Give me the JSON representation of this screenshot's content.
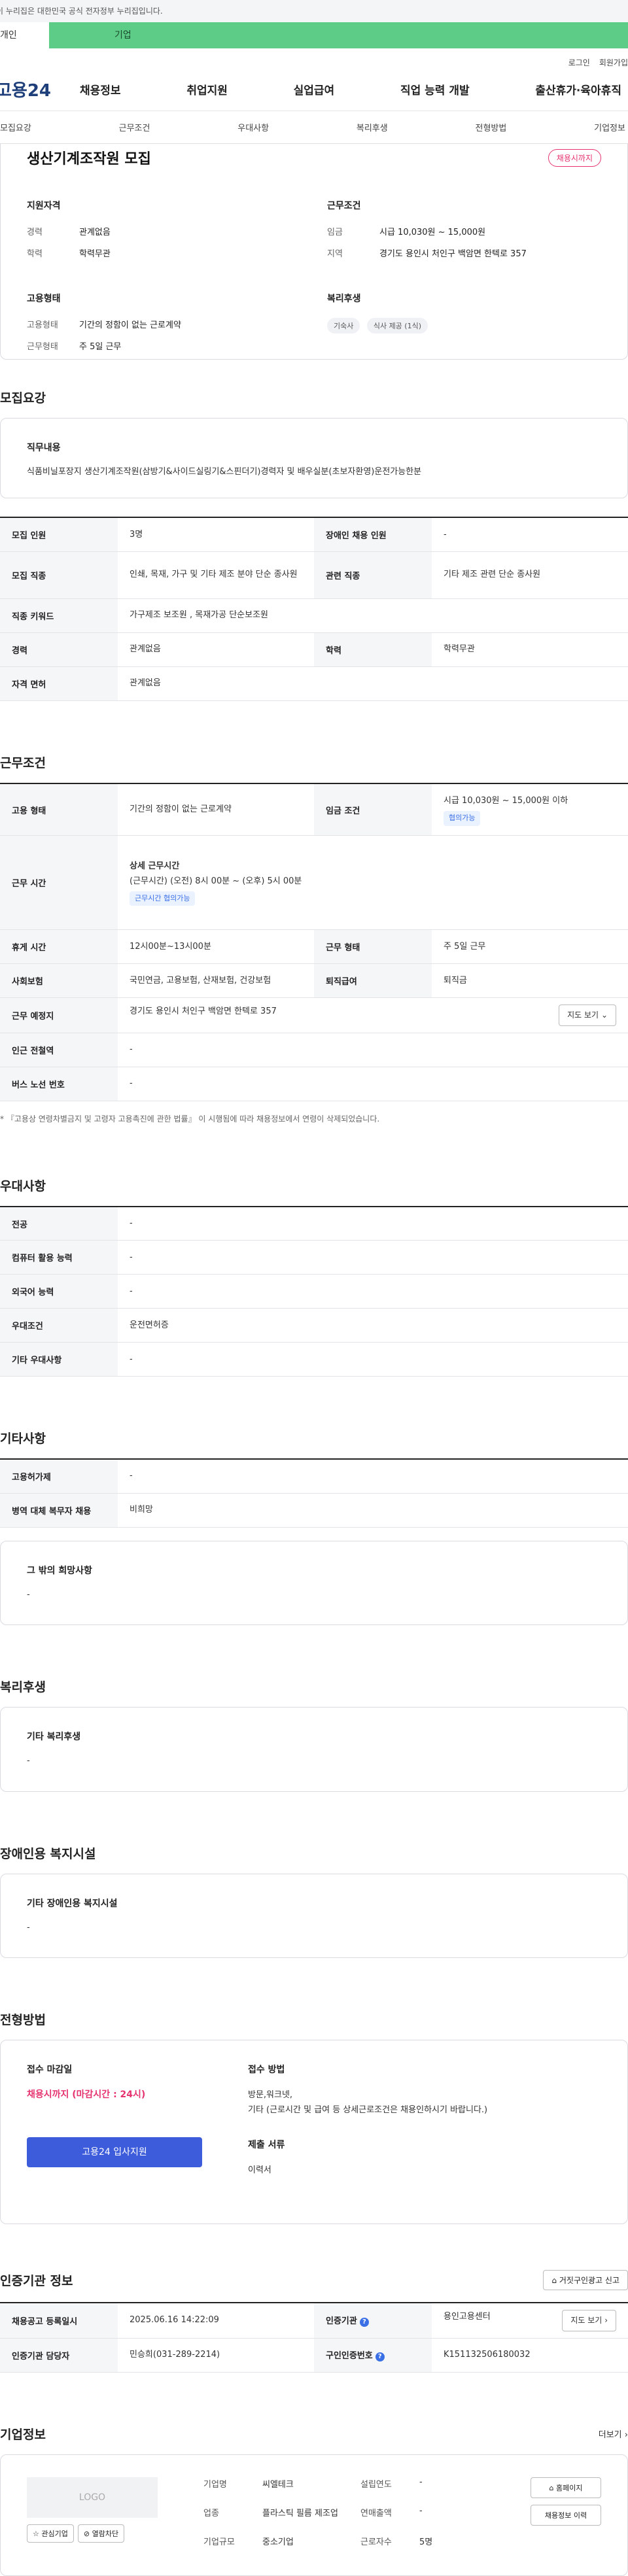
{
  "banner": {
    "text": "이 누리집은 대한민국 공식 전자정부 누리집입니다."
  },
  "audience": {
    "tabs": [
      "개인",
      "기업"
    ]
  },
  "util": {
    "login": "로그인",
    "signup": "회원가입"
  },
  "gnb": {
    "logo": "고용24",
    "items": [
      "채용정보",
      "취업지원",
      "실업급여",
      "직업 능력 개발",
      "출산휴가·육아휴직"
    ]
  },
  "anchors": [
    "모집요강",
    "근무조건",
    "우대사항",
    "복리후생",
    "전형방법",
    "기업정보"
  ],
  "summary": {
    "title": "생산기계조작원 모집",
    "badge": "채용시까지",
    "qualification": {
      "title": "지원자격",
      "rows": [
        {
          "k": "경력",
          "v": "관계없음"
        },
        {
          "k": "학력",
          "v": "학력무관"
        }
      ]
    },
    "condition": {
      "title": "근무조건",
      "rows": [
        {
          "k": "임금",
          "v": "시급 10,030원 ~ 15,000원"
        },
        {
          "k": "지역",
          "v": "경기도 용인시 처인구 백암면 한텍로 357"
        }
      ]
    },
    "employment": {
      "title": "고용형태",
      "rows": [
        {
          "k": "고용형태",
          "v": "기간의 정함이 없는 근로계약"
        },
        {
          "k": "근무형태",
          "v": "주 5일 근무"
        }
      ]
    },
    "welfare": {
      "title": "복리후생",
      "tags": [
        "기숙사",
        "식사 제공 (1식)"
      ]
    }
  },
  "recruit": {
    "title": "모집요강",
    "duty_title": "직무내용",
    "duty_body": "식품비닐포장지 생산기계조작원(삼방기&사이드실링기&스핀더기)경력자 및 배우실분(초보자환영)운전가능한분",
    "rows": [
      {
        "k1": "모집 인원",
        "v1": "3명",
        "k2": "장애인 채용 인원",
        "v2": "-"
      },
      {
        "k1": "모집 직종",
        "v1": "인쇄, 목재, 가구 및 기타 제조 분야 단순 종사원",
        "k2": "관련 직종",
        "v2": "기타 제조 관련 단순 종사원"
      },
      {
        "k1": "직종 키워드",
        "v1": "가구제조 보조원 , 목재가공 단순보조원"
      },
      {
        "k1": "경력",
        "v1": "관계없음",
        "k2": "학력",
        "v2": "학력무관"
      },
      {
        "k1": "자격 면허",
        "v1": "관계없음"
      }
    ]
  },
  "work": {
    "title": "근무조건",
    "employ_type_label": "고용 형태",
    "employ_type": "기간의 정함이 없는 근로계약",
    "wage_label": "임금 조건",
    "wage": "시급 10,030원 ~ 15,000원 이하",
    "wage_tag": "협의가능",
    "hours_label": "근무 시간",
    "hours_title": "상세 근무시간",
    "hours_body": "(근무시간) (오전) 8시 00분 ~ (오후) 5시 00분",
    "hours_tag": "근무시간 협의가능",
    "break_label": "휴게 시간",
    "break": "12시00분~13시00분",
    "worktype_label": "근무 형태",
    "worktype": "주 5일 근무",
    "insurance_label": "사회보험",
    "insurance": "국민연금, 고용보험, 산재보험, 건강보험",
    "retire_label": "퇴직급여",
    "retire": "퇴직금",
    "place_label": "근무 예정지",
    "place": "경기도 용인시 처인구 백암면 한텍로 357",
    "map_btn": "지도 보기",
    "subway_label": "인근 전철역",
    "subway": "-",
    "bus_label": "버스 노선 번호",
    "bus": "-",
    "footnote": "* 『고용상 연령차별금지 및 고령자 고용촉진에 관한 법률』 이 시행됨에 따라 채용정보에서 연령이 삭제되었습니다."
  },
  "prefer": {
    "title": "우대사항",
    "rows": [
      {
        "k": "전공",
        "v": "-"
      },
      {
        "k": "컴퓨터 활용 능력",
        "v": "-"
      },
      {
        "k": "외국어 능력",
        "v": "-"
      },
      {
        "k": "우대조건",
        "v": "운전면허증"
      },
      {
        "k": "기타 우대사항",
        "v": "-"
      }
    ]
  },
  "etc": {
    "title": "기타사항",
    "rows": [
      {
        "k": "고용허가제",
        "v": "-"
      },
      {
        "k": "병역 대체 복무자 채용",
        "v": "비희망"
      }
    ],
    "card_title": "그 밖의 희망사항",
    "card_body": "-"
  },
  "welfare": {
    "title": "복리후생",
    "card_title": "기타 복리후생",
    "card_body": "-"
  },
  "disabled": {
    "title": "장애인용 복지시설",
    "card_title": "기타 장애인용 복지시설",
    "card_body": "-"
  },
  "process": {
    "title": "전형방법",
    "deadline_label": "접수 마감일",
    "deadline": "채용시까지 (마감시간 : 24시)",
    "apply_btn": "고용24 입사지원",
    "method_label": "접수 방법",
    "method_body": "방문,워크넷,\n기타 (근로시간 및 급여 등 상세근로조건은 채용인하시기 바랍니다.)",
    "docs_label": "제출 서류",
    "docs_body": "이력서"
  },
  "cert": {
    "title": "인증기관 정보",
    "report_btn": "거짓구인광고 신고",
    "reg_date_label": "채용공고 등록일시",
    "reg_date": "2025.06.16 14:22:09",
    "agency_label": "인증기관",
    "agency": "용인고용센터",
    "map_btn": "지도 보기",
    "manager_label": "인증기관 담당자",
    "manager": "민승희(031-289-2214)",
    "certno_label": "구인인증번호",
    "certno": "K151132506180032"
  },
  "company": {
    "title": "기업정보",
    "more": "더보기",
    "logo": "LOGO",
    "fav_btn": "관심기업",
    "block_btn": "열람차단",
    "info": [
      {
        "k": "기업명",
        "v": "씨엘테크"
      },
      {
        "k": "설립연도",
        "v": "-"
      },
      {
        "k": "업종",
        "v": "플라스틱 필름 제조업"
      },
      {
        "k": "연매출액",
        "v": "-"
      },
      {
        "k": "기업규모",
        "v": "중소기업"
      },
      {
        "k": "근로자수",
        "v": "5명"
      }
    ],
    "homepage_btn": "홈페이지",
    "history_btn": "채용정보 이력"
  }
}
